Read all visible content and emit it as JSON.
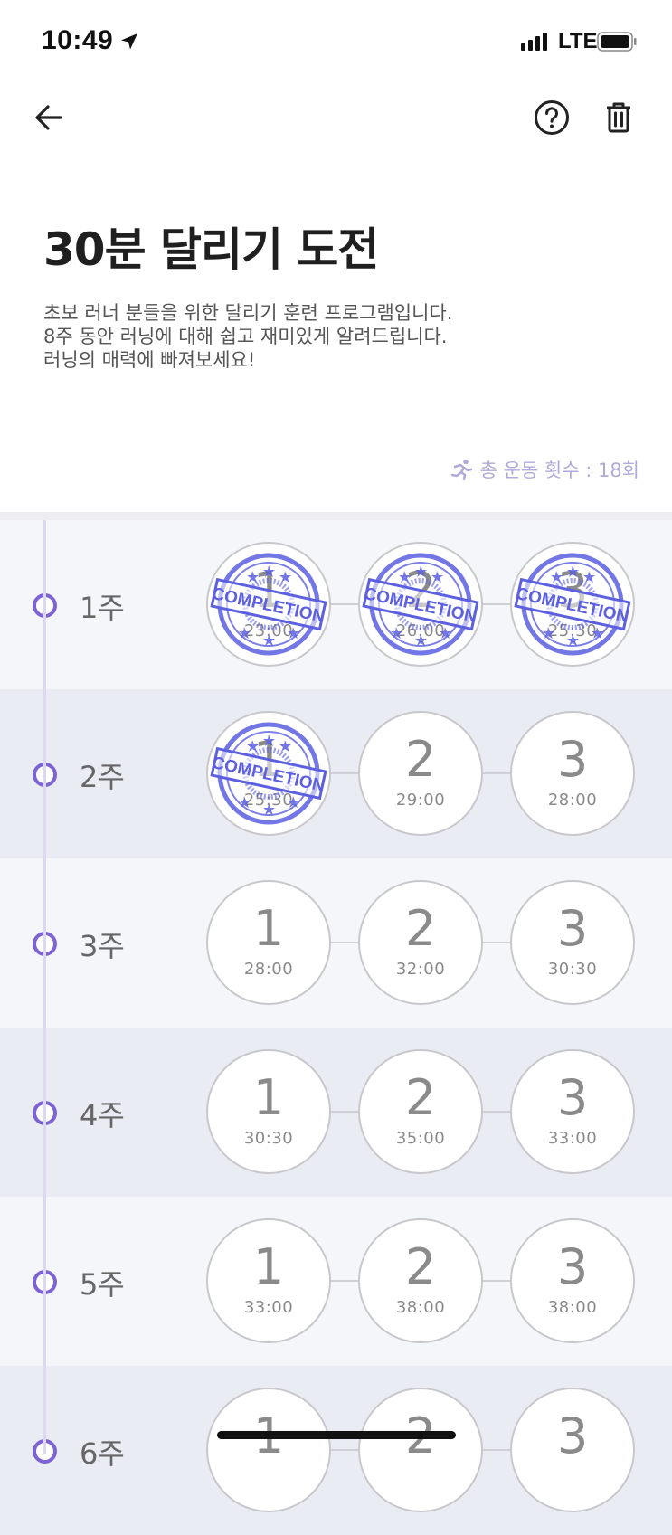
{
  "status_bar": {
    "time": "10:49",
    "network": "LTE"
  },
  "nav": {
    "back_icon": "arrow-left-icon",
    "help_icon": "question-circle-icon",
    "delete_icon": "trash-icon"
  },
  "program": {
    "title": "30분 달리기 도전",
    "description": [
      "초보 러너 분들을 위한 달리기 훈련 프로그램입니다.",
      "8주 동안 러닝에 대해 쉽고 재미있게 알려드립니다.",
      "러닝의 매력에 빠져보세요!"
    ],
    "total_label": "총 운동 횟수 : 18회"
  },
  "colors": {
    "accent": "#7d63d4",
    "stamp": "#5b5fe0",
    "muted": "#b0aad8"
  },
  "stamp_text": "COMPLETION",
  "weeks": [
    {
      "label": "1주",
      "sessions": [
        {
          "num": "1",
          "time": "23:00",
          "completed": true
        },
        {
          "num": "2",
          "time": "26:00",
          "completed": true
        },
        {
          "num": "3",
          "time": "25:30",
          "completed": true
        }
      ]
    },
    {
      "label": "2주",
      "sessions": [
        {
          "num": "1",
          "time": "25:30",
          "completed": true
        },
        {
          "num": "2",
          "time": "29:00",
          "completed": false
        },
        {
          "num": "3",
          "time": "28:00",
          "completed": false
        }
      ]
    },
    {
      "label": "3주",
      "sessions": [
        {
          "num": "1",
          "time": "28:00",
          "completed": false
        },
        {
          "num": "2",
          "time": "32:00",
          "completed": false
        },
        {
          "num": "3",
          "time": "30:30",
          "completed": false
        }
      ]
    },
    {
      "label": "4주",
      "sessions": [
        {
          "num": "1",
          "time": "30:30",
          "completed": false
        },
        {
          "num": "2",
          "time": "35:00",
          "completed": false
        },
        {
          "num": "3",
          "time": "33:00",
          "completed": false
        }
      ]
    },
    {
      "label": "5주",
      "sessions": [
        {
          "num": "1",
          "time": "33:00",
          "completed": false
        },
        {
          "num": "2",
          "time": "38:00",
          "completed": false
        },
        {
          "num": "3",
          "time": "38:00",
          "completed": false
        }
      ]
    },
    {
      "label": "6주",
      "sessions": [
        {
          "num": "1",
          "time": "",
          "completed": false
        },
        {
          "num": "2",
          "time": "",
          "completed": false
        },
        {
          "num": "3",
          "time": "",
          "completed": false
        }
      ]
    }
  ]
}
